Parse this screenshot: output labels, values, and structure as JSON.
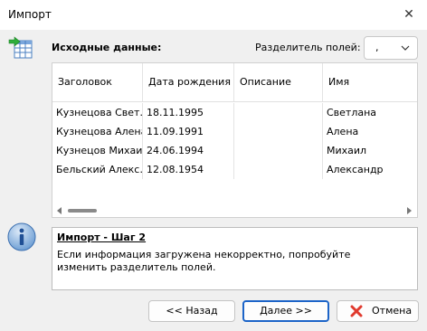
{
  "window": {
    "title": "Импорт",
    "close_glyph": "✕"
  },
  "source": {
    "heading": "Исходные данные:"
  },
  "separator": {
    "label": "Разделитель полей:",
    "value": ","
  },
  "grid": {
    "columns": [
      "Заголовок",
      "Дата рождения",
      "Описание",
      "Имя"
    ],
    "rows": [
      [
        "Кузнецова Свет…",
        "18.11.1995",
        "",
        "Светлана"
      ],
      [
        "Кузнецова Алена",
        "11.09.1991",
        "",
        "Алена"
      ],
      [
        "Кузнецов Михаил",
        "24.06.1994",
        "",
        "Михаил"
      ],
      [
        "Бельский Алекс…",
        "12.08.1954",
        "",
        "Александр"
      ]
    ]
  },
  "step": {
    "title": "Импорт - Шаг 2",
    "text": "Если информация загружена некорректно, попробуйте изменить разделитель полей."
  },
  "buttons": {
    "back": "<< Назад",
    "next": "Далее >>",
    "cancel": "Отмена"
  },
  "colors": {
    "accent": "#1c64c8",
    "cancel_red": "#e03a2e",
    "info_blue": "#3b82c8"
  }
}
